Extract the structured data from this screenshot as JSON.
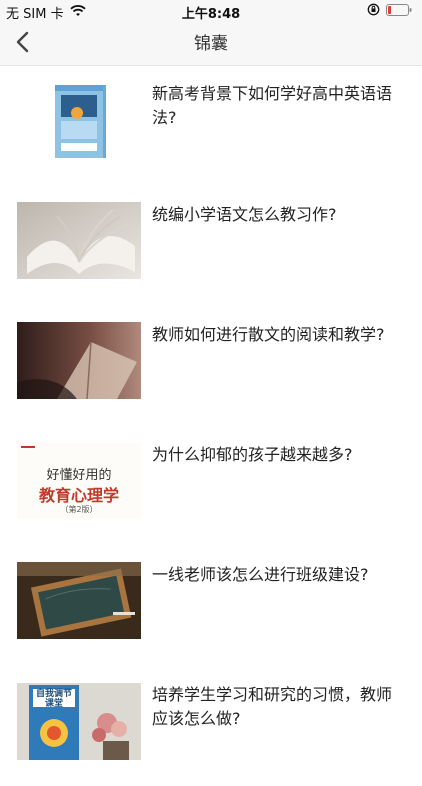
{
  "status": {
    "carrier": "无 SIM 卡",
    "time": "上午8:48"
  },
  "nav": {
    "title": "锦囊"
  },
  "items": [
    {
      "title": "新高考背景下如何学好高中英语语法?",
      "cover_text": [
        "高中英语",
        "语法全解"
      ]
    },
    {
      "title": "统编小学语文怎么教习作?"
    },
    {
      "title": "教师如何进行散文的阅读和教学?"
    },
    {
      "title": "为什么抑郁的孩子越来越多?",
      "cover_text": [
        "好懂好用的",
        "教育心理学",
        "（第2版）"
      ]
    },
    {
      "title": "一线老师该怎么进行班级建设?"
    },
    {
      "title": "培养学生学习和研究的习惯，教师应该怎么做?",
      "cover_text": [
        "自我调节",
        "课堂"
      ]
    }
  ],
  "colors": {
    "bar_bg": "#f7f7f7",
    "text": "#222222",
    "battery_low": "#e53935"
  }
}
